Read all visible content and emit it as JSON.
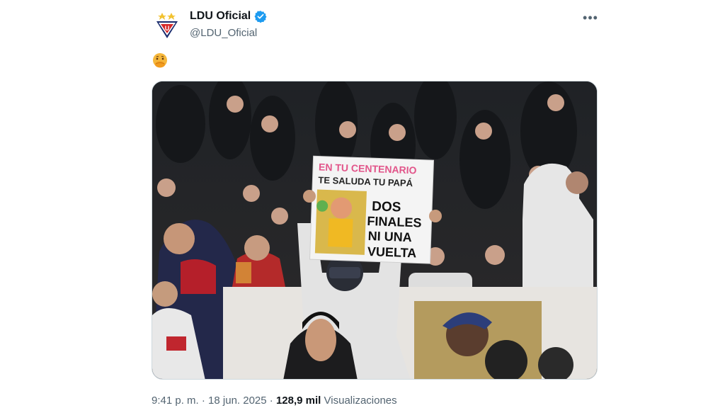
{
  "account": {
    "display_name": "LDU Oficial",
    "handle": "@LDU_Oficial",
    "verified_color": "#1d9bf0"
  },
  "tweet": {
    "emoji_icon": "smiling-face-with-hand-over-mouth"
  },
  "photo": {
    "sign_line_1": "EN TU CENTENARIO",
    "sign_line_2": "TE SALUDA TU PAPÁ",
    "sign_line_3": "DOS",
    "sign_line_4": "FINALES",
    "sign_line_5": "NI UNA",
    "sign_line_6": "VUELTA"
  },
  "meta": {
    "time": "9:41 p. m.",
    "date": "18 jun. 2025",
    "views_count": "128,9 mil",
    "views_label": "Visualizaciones"
  }
}
